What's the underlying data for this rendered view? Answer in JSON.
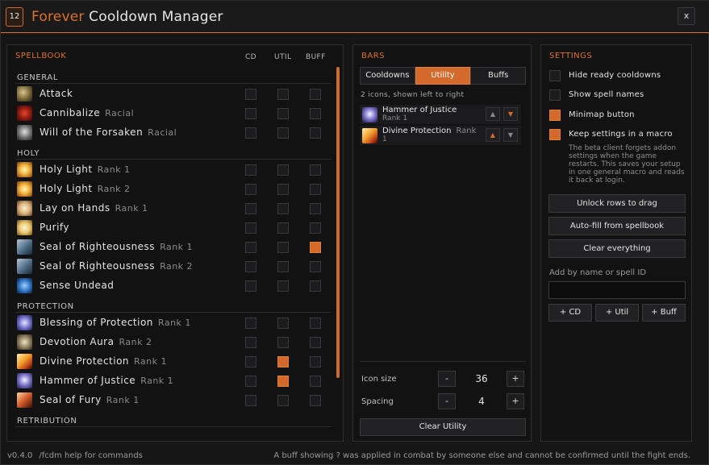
{
  "window": {
    "icon_text": "12",
    "title_accent": "Forever",
    "title_rest": "Cooldown Manager",
    "close_label": "x"
  },
  "spellbook": {
    "title": "SPELLBOOK",
    "columns": [
      "CD",
      "UTIL",
      "BUFF"
    ],
    "categories": [
      "GENERAL",
      "HOLY",
      "PROTECTION",
      "RETRIBUTION"
    ],
    "rows": [
      {
        "name": "Attack",
        "sub": "",
        "icon": "attack-icon",
        "cd": false,
        "util": false,
        "buff": false
      },
      {
        "name": "Cannibalize",
        "sub": "Racial",
        "icon": "cannibalize-icon",
        "cd": false,
        "util": false,
        "buff": false
      },
      {
        "name": "Will of the Forsaken",
        "sub": "Racial",
        "icon": "will-of-the-forsaken-icon",
        "cd": false,
        "util": false,
        "buff": false
      },
      {
        "name": "Holy Light",
        "sub": "Rank 1",
        "icon": "holy-light-icon",
        "cd": false,
        "util": false,
        "buff": false
      },
      {
        "name": "Holy Light",
        "sub": "Rank 2",
        "icon": "holy-light-icon",
        "cd": false,
        "util": false,
        "buff": false
      },
      {
        "name": "Lay on Hands",
        "sub": "Rank 1",
        "icon": "lay-on-hands-icon",
        "cd": false,
        "util": false,
        "buff": false
      },
      {
        "name": "Purify",
        "sub": "",
        "icon": "purify-icon",
        "cd": false,
        "util": false,
        "buff": false
      },
      {
        "name": "Seal of Righteousness",
        "sub": "Rank 1",
        "icon": "seal-of-righteousness-icon",
        "cd": false,
        "util": false,
        "buff": true
      },
      {
        "name": "Seal of Righteousness",
        "sub": "Rank 2",
        "icon": "seal-of-righteousness-icon",
        "cd": false,
        "util": false,
        "buff": false
      },
      {
        "name": "Sense Undead",
        "sub": "",
        "icon": "sense-undead-icon",
        "cd": false,
        "util": false,
        "buff": false
      },
      {
        "name": "Blessing of Protection",
        "sub": "Rank 1",
        "icon": "blessing-of-protection-icon",
        "cd": false,
        "util": false,
        "buff": false
      },
      {
        "name": "Devotion Aura",
        "sub": "Rank 2",
        "icon": "devotion-aura-icon",
        "cd": false,
        "util": false,
        "buff": false
      },
      {
        "name": "Divine Protection",
        "sub": "Rank 1",
        "icon": "divine-protection-icon",
        "cd": false,
        "util": true,
        "buff": false
      },
      {
        "name": "Hammer of Justice",
        "sub": "Rank 1",
        "icon": "hammer-of-justice-icon",
        "cd": false,
        "util": true,
        "buff": false
      },
      {
        "name": "Seal of Fury",
        "sub": "Rank 1",
        "icon": "seal-of-fury-icon",
        "cd": false,
        "util": false,
        "buff": false
      }
    ]
  },
  "bars": {
    "title": "BARS",
    "tabs": [
      "Cooldowns",
      "Utility",
      "Buffs"
    ],
    "active_tab": "Utility",
    "hint": "2 icons, shown left to right",
    "items": [
      {
        "name": "Hammer of Justice",
        "rank": "Rank 1",
        "icon": "hammer-of-justice-icon"
      },
      {
        "name": "Divine Protection",
        "rank": "Rank",
        "rank2": "1",
        "icon": "divine-protection-icon"
      }
    ],
    "icon_size_label": "Icon size",
    "icon_size_value": "36",
    "spacing_label": "Spacing",
    "spacing_value": "4",
    "minus": "-",
    "plus": "+",
    "clear_button": "Clear Utility"
  },
  "settings": {
    "title": "SETTINGS",
    "options": [
      {
        "label": "Hide ready cooldowns",
        "checked": false
      },
      {
        "label": "Show spell names",
        "checked": false
      },
      {
        "label": "Minimap button",
        "checked": true
      },
      {
        "label": "Keep settings in a macro",
        "checked": true
      }
    ],
    "note": "The beta client forgets addon settings when the game restarts. This saves your setup in one general macro and reads it back at login.",
    "buttons": [
      "Unlock rows to drag",
      "Auto-fill from spellbook",
      "Clear everything"
    ],
    "add_label": "Add by name or spell ID",
    "add_input_value": "",
    "add_buttons": [
      "+ CD",
      "+ Util",
      "+ Buff"
    ]
  },
  "footer": {
    "version": "v0.4.0",
    "help": "/fcdm help for commands",
    "note": "A buff showing ? was applied in combat by someone else and cannot be confirmed until the fight ends."
  },
  "colors": {
    "accent": "#d3692a",
    "background": "#161617"
  }
}
